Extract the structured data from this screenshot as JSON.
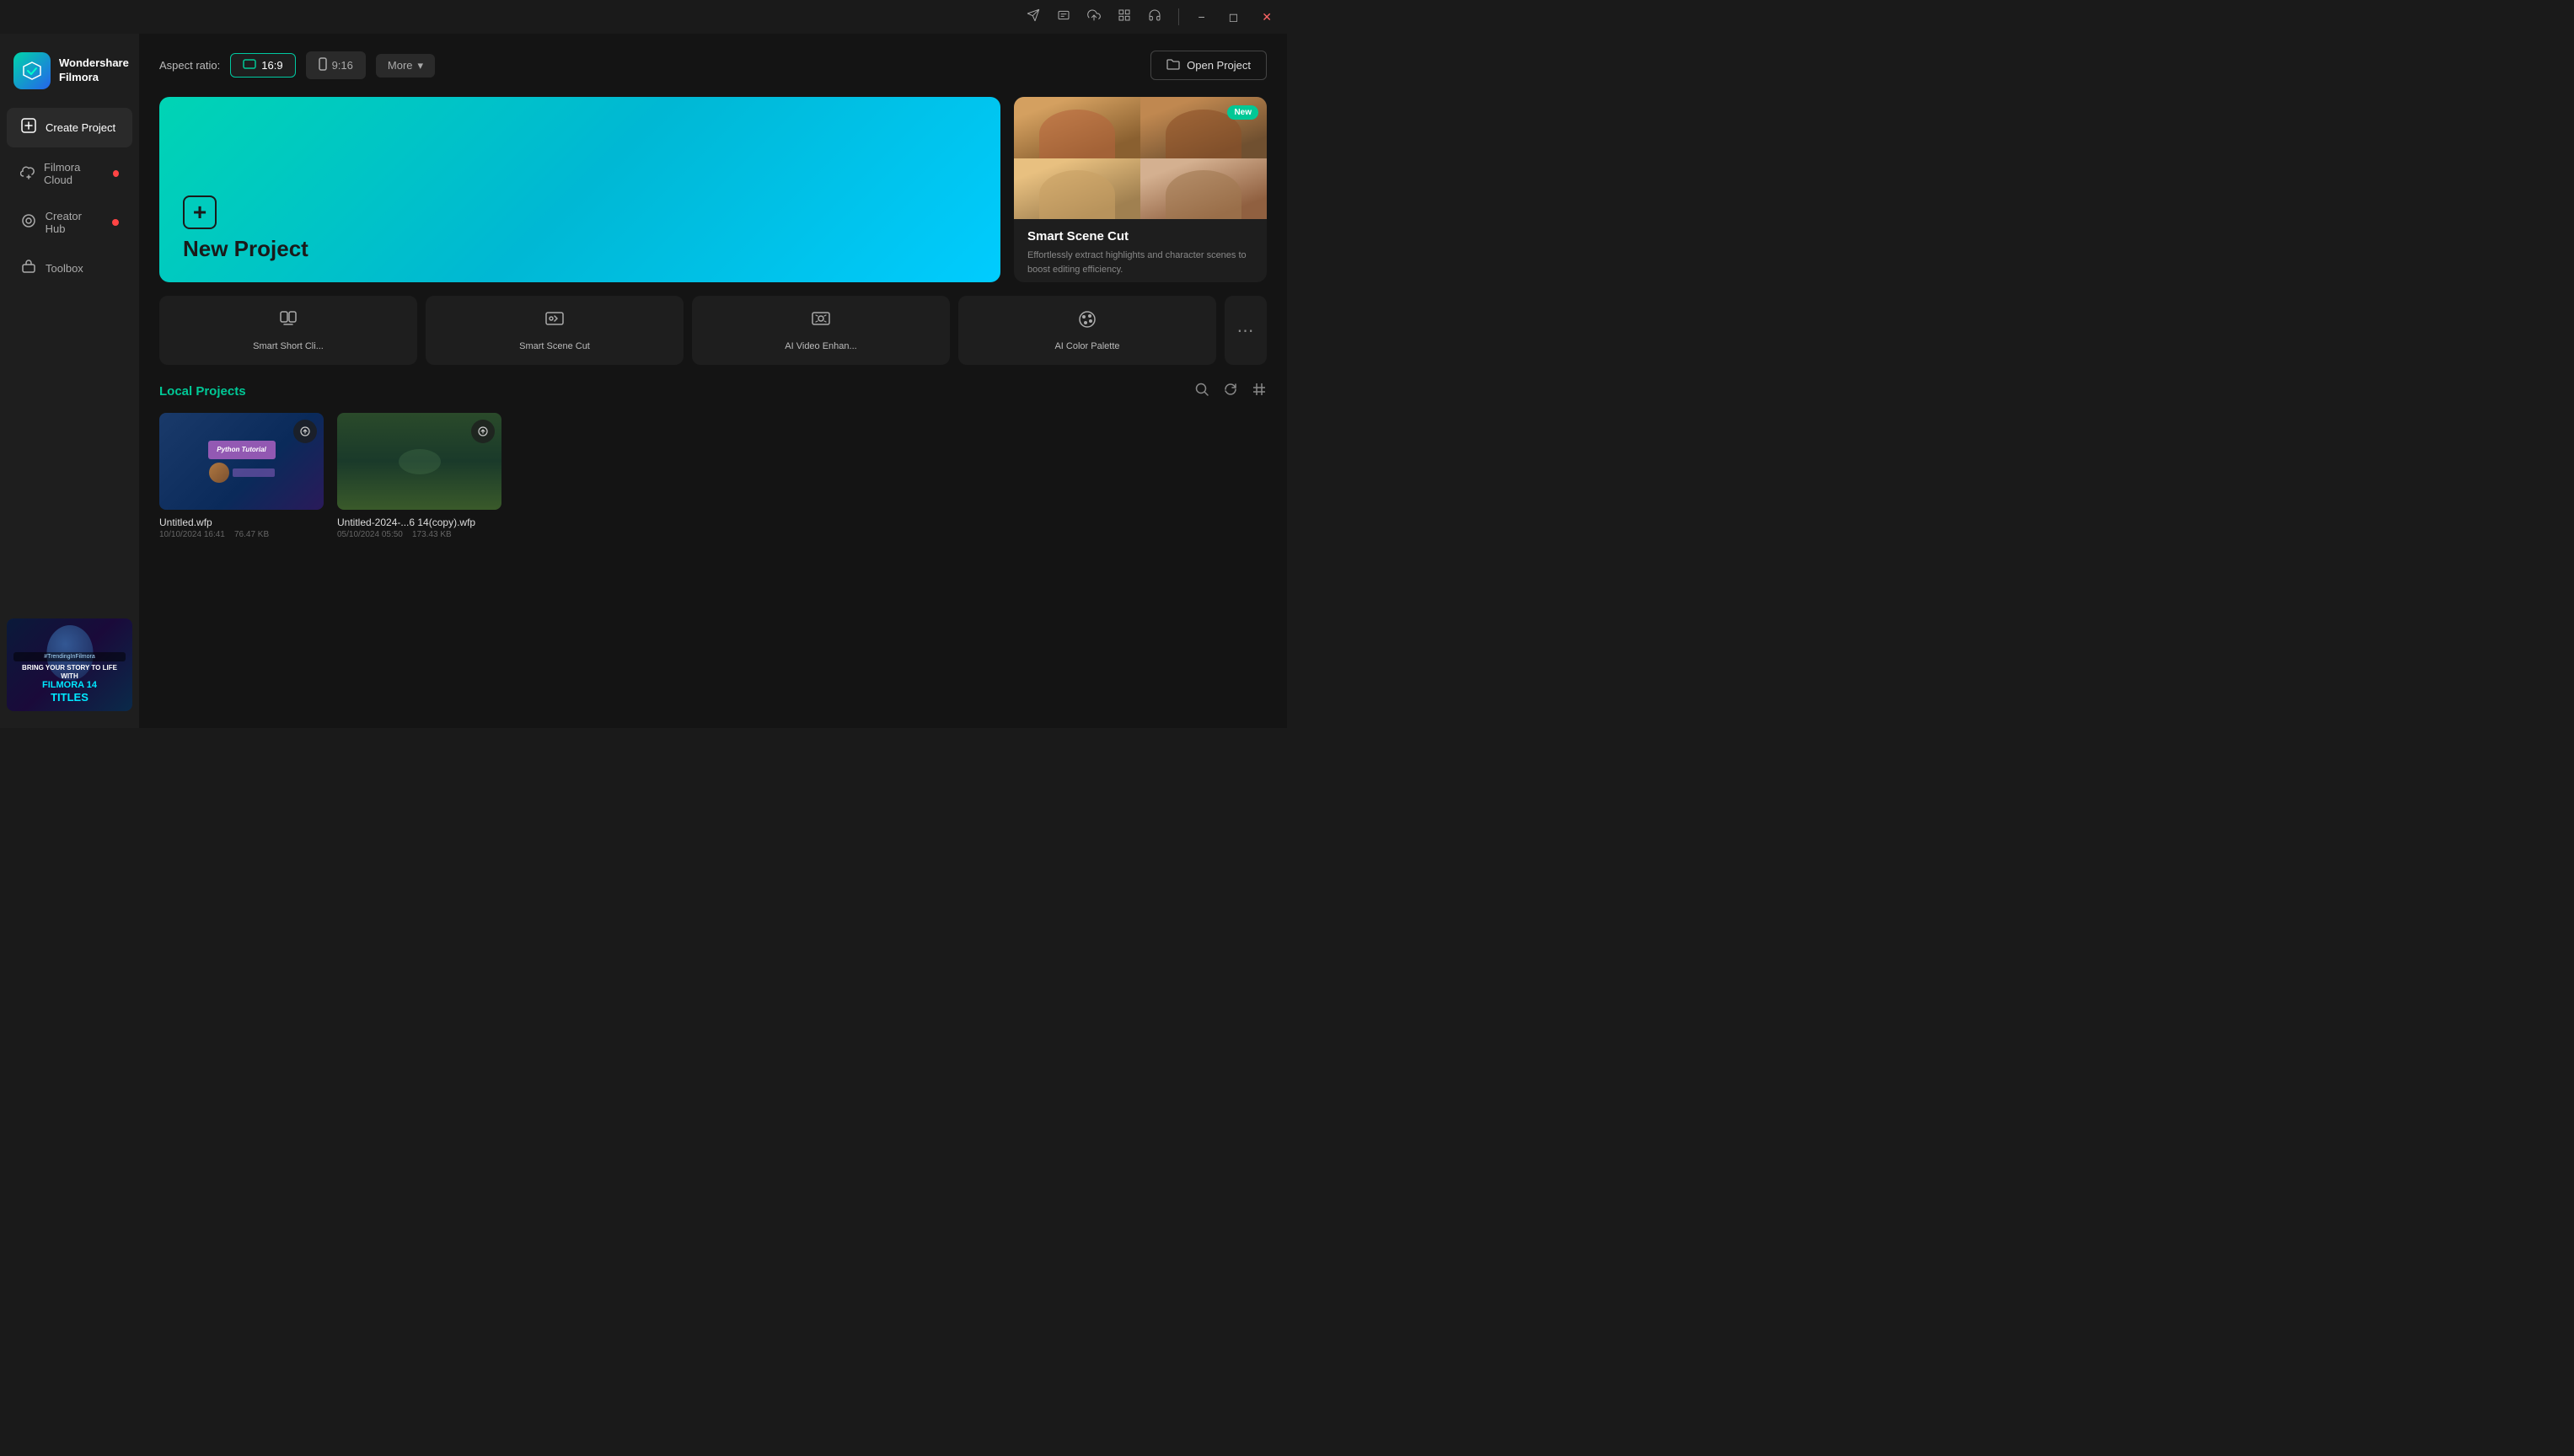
{
  "app": {
    "name": "Wondershare Filmora",
    "logo_text_line1": "Wondershare",
    "logo_text_line2": "Filmora"
  },
  "titlebar": {
    "icons": [
      "share-icon",
      "captions-icon",
      "upload-icon",
      "grid-icon",
      "headset-icon"
    ],
    "window_controls": [
      "minimize-icon",
      "maximize-icon",
      "close-icon"
    ]
  },
  "sidebar": {
    "items": [
      {
        "id": "create-project",
        "label": "Create Project",
        "active": true,
        "dot": false
      },
      {
        "id": "filmora-cloud",
        "label": "Filmora Cloud",
        "active": false,
        "dot": true
      },
      {
        "id": "creator-hub",
        "label": "Creator Hub",
        "active": false,
        "dot": true
      },
      {
        "id": "toolbox",
        "label": "Toolbox",
        "active": false,
        "dot": false
      }
    ],
    "banner": {
      "tag": "#TrendingInFilmora",
      "line1": "BRING YOUR STORY TO LIFE WITH",
      "line2": "FILMORA 14",
      "line3": "TITLES"
    }
  },
  "aspect_ratio": {
    "label": "Aspect ratio:",
    "options": [
      {
        "id": "16-9",
        "label": "16:9",
        "active": true
      },
      {
        "id": "9-16",
        "label": "9:16",
        "active": false
      }
    ],
    "more_label": "More"
  },
  "open_project": {
    "label": "Open Project"
  },
  "new_project": {
    "title": "New Project"
  },
  "feature_card": {
    "badge": "New",
    "title": "Smart Scene Cut",
    "description": "Effortlessly extract highlights and character scenes to boost editing efficiency.",
    "dots": [
      false,
      true,
      false,
      false,
      false,
      false
    ]
  },
  "tools": [
    {
      "id": "smart-short-clip",
      "label": "Smart Short Cli...",
      "icon": "📱"
    },
    {
      "id": "smart-scene-cut",
      "label": "Smart Scene Cut",
      "icon": "🎬"
    },
    {
      "id": "ai-video-enhance",
      "label": "AI Video Enhan...",
      "icon": "✨"
    },
    {
      "id": "ai-color-palette",
      "label": "AI Color Palette",
      "icon": "🎨"
    }
  ],
  "local_projects": {
    "title": "Local Projects",
    "projects": [
      {
        "id": "project-1",
        "name": "Untitled.wfp",
        "date": "10/10/2024 16:41",
        "size": "76.47 KB",
        "has_upload": true
      },
      {
        "id": "project-2",
        "name": "Untitled-2024-...6 14(copy).wfp",
        "date": "05/10/2024 05:50",
        "size": "173.43 KB",
        "has_upload": true
      }
    ]
  }
}
